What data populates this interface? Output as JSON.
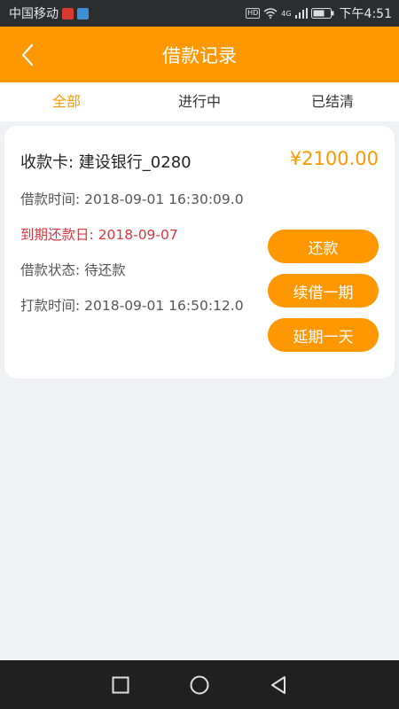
{
  "status_bar": {
    "carrier": "中国移动",
    "network": "4G",
    "hd": "HD",
    "time": "下午4:51"
  },
  "header": {
    "title": "借款记录",
    "back_icon": "chevron-left-icon"
  },
  "tabs": [
    {
      "label": "全部",
      "active": true
    },
    {
      "label": "进行中",
      "active": false
    },
    {
      "label": "已结清",
      "active": false
    }
  ],
  "loan_card": {
    "card_label": "收款卡: 建设银行_0280",
    "amount": "¥2100.00",
    "loan_time": "借款时间: 2018-09-01 16:30:09.0",
    "due_date": "到期还款日: 2018-09-07",
    "status": "借款状态: 待还款",
    "payout_time": "打款时间: 2018-09-01 16:50:12.0",
    "buttons": {
      "repay": "还款",
      "renew": "续借一期",
      "extend": "延期一天"
    }
  },
  "nav_bar": {
    "icons": [
      "square-icon",
      "circle-icon",
      "triangle-back-icon"
    ]
  },
  "colors": {
    "accent": "#ff9800",
    "due_red": "#d9363e",
    "background": "#eff1f5"
  }
}
